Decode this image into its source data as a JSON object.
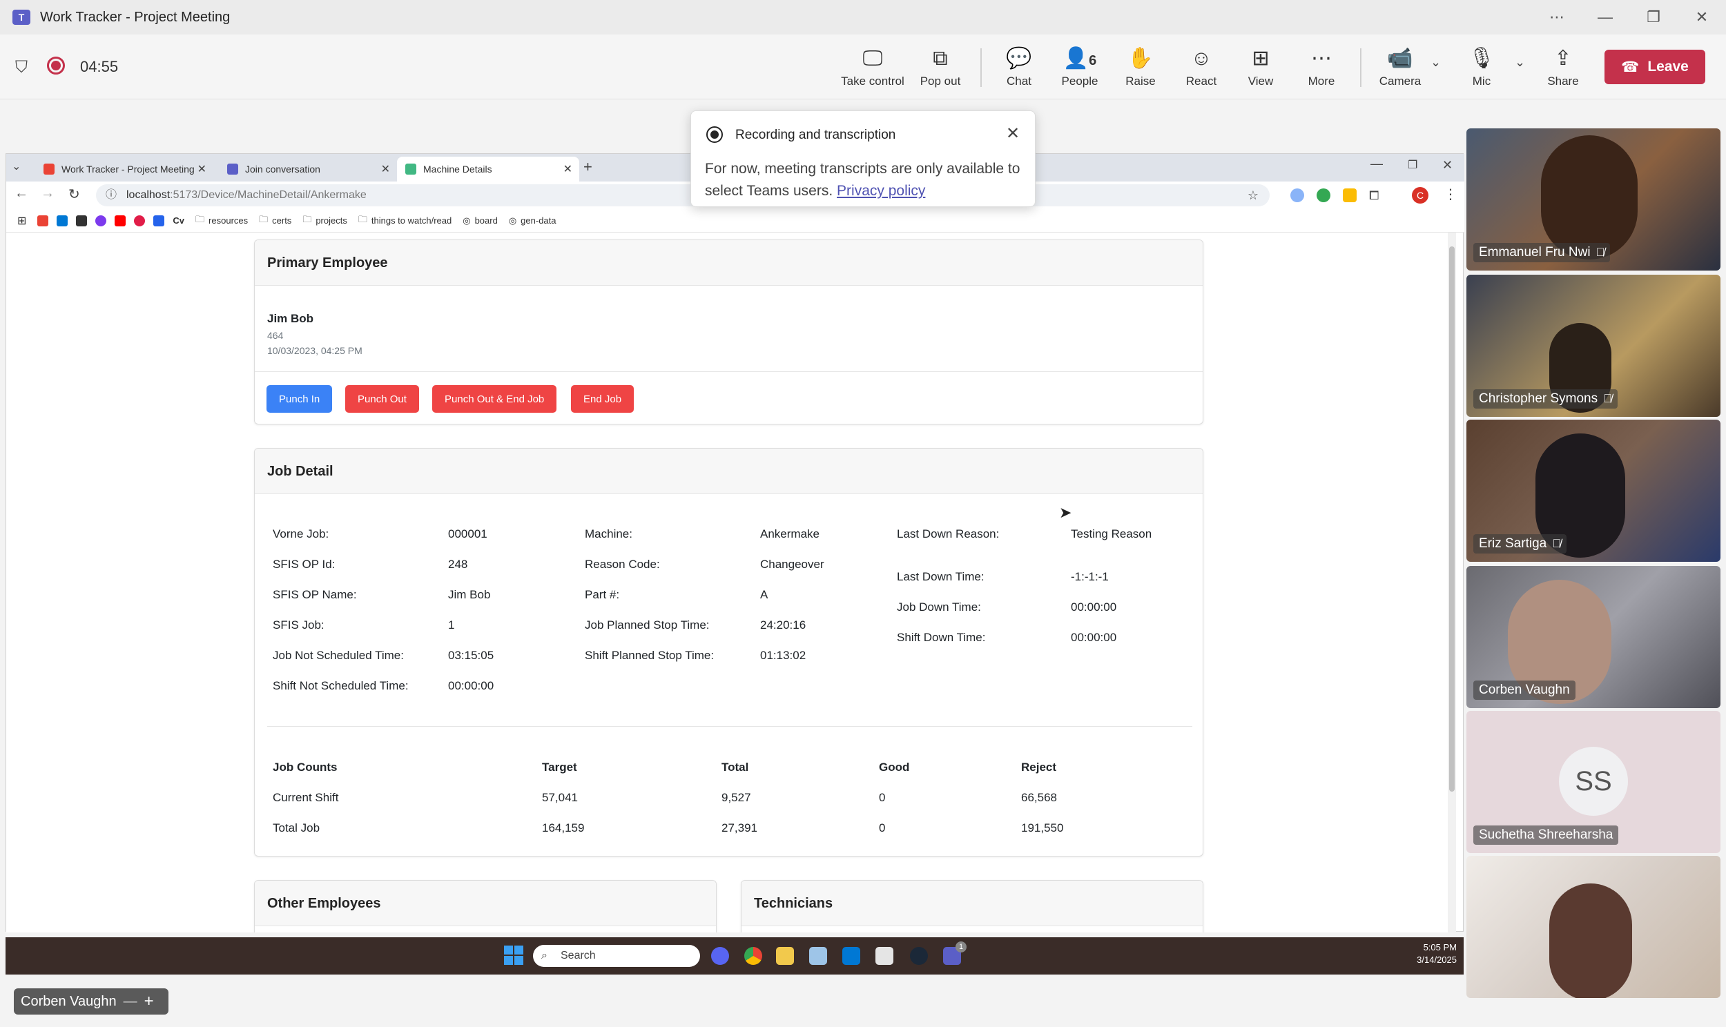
{
  "window": {
    "title": "Work Tracker - Project Meeting"
  },
  "meeting": {
    "timer": "04:55",
    "toolbar": {
      "take_control": "Take control",
      "pop_out": "Pop out",
      "chat": "Chat",
      "people": "People",
      "people_count": "6",
      "raise": "Raise",
      "react": "React",
      "view": "View",
      "more": "More",
      "camera": "Camera",
      "mic": "Mic",
      "share": "Share",
      "leave": "Leave"
    }
  },
  "toast": {
    "title": "Recording and transcription",
    "body": "For now, meeting transcripts are only available to select Teams users.",
    "link": "Privacy policy"
  },
  "browser": {
    "tabs": [
      {
        "label": "Work Tracker - Project Meeting"
      },
      {
        "label": "Join conversation"
      },
      {
        "label": "Machine Details"
      }
    ],
    "url_host": "localhost",
    "url_path": ":5173/Device/MachineDetail/Ankermake",
    "bookmarks": [
      "resources",
      "certs",
      "projects",
      "things to watch/read",
      "board",
      "gen-data"
    ]
  },
  "primary_employee": {
    "header": "Primary Employee",
    "name": "Jim Bob",
    "id": "464",
    "timestamp": "10/03/2023, 04:25 PM",
    "buttons": {
      "punch_in": "Punch In",
      "punch_out": "Punch Out",
      "punch_out_end": "Punch Out & End Job",
      "end_job": "End Job"
    }
  },
  "job_detail": {
    "header": "Job Detail",
    "col1": [
      {
        "label": "Vorne Job:",
        "value": "000001"
      },
      {
        "label": "SFIS OP Id:",
        "value": "248"
      },
      {
        "label": "SFIS OP Name:",
        "value": "Jim Bob"
      },
      {
        "label": "SFIS Job:",
        "value": "1"
      },
      {
        "label": "Job Not Scheduled Time:",
        "value": "03:15:05"
      },
      {
        "label": "Shift Not Scheduled Time:",
        "value": "00:00:00"
      }
    ],
    "col2": [
      {
        "label": "Machine:",
        "value": "Ankermake"
      },
      {
        "label": "Reason Code:",
        "value": "Changeover"
      },
      {
        "label": "Part #:",
        "value": "A"
      },
      {
        "label": "Job Planned Stop Time:",
        "value": "24:20:16"
      },
      {
        "label": "Shift Planned Stop Time:",
        "value": "01:13:02"
      }
    ],
    "col3": [
      {
        "label": "Last Down Reason:",
        "value": "Testing Reason"
      },
      {
        "label": "Last Down Time:",
        "value": "-1:-1:-1"
      },
      {
        "label": "Job Down Time:",
        "value": "00:00:00"
      },
      {
        "label": "Shift Down Time:",
        "value": "00:00:00"
      }
    ],
    "counts": {
      "headers": [
        "Job Counts",
        "Target",
        "Total",
        "Good",
        "Reject"
      ],
      "rows": [
        [
          "Current Shift",
          "57,041",
          "9,527",
          "0",
          "66,568"
        ],
        [
          "Total Job",
          "164,159",
          "27,391",
          "0",
          "191,550"
        ]
      ]
    }
  },
  "other_employees": {
    "header": "Other Employees"
  },
  "technicians": {
    "header": "Technicians"
  },
  "taskbar": {
    "search": "Search",
    "time": "5:05 PM",
    "date": "3/14/2025",
    "badge": "1"
  },
  "participants": [
    {
      "name": "Emmanuel Fru Nwi"
    },
    {
      "name": "Christopher Symons"
    },
    {
      "name": "Eriz Sartiga"
    },
    {
      "name": "Corben Vaughn"
    },
    {
      "name": "Suchetha Shreeharsha",
      "initials": "SS"
    },
    {
      "name": ""
    }
  ],
  "spotlight": {
    "name": "Corben Vaughn"
  },
  "colors": {
    "leave": "#c4314b",
    "punch_in": "#3b82f6",
    "danger": "#ef4444",
    "teams": "#5b5fc7"
  }
}
